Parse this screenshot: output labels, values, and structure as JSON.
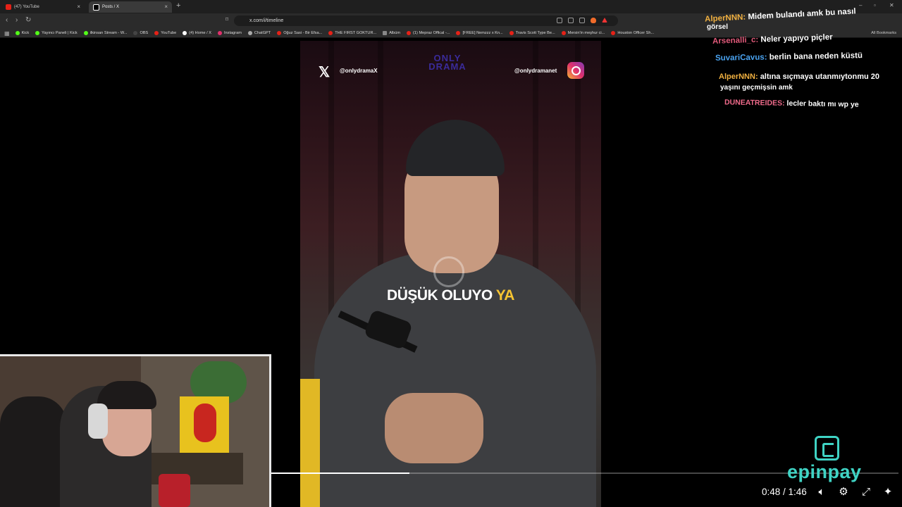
{
  "browser": {
    "tabs": [
      {
        "label": "(47) YouTube",
        "favicon_color": "#e62117"
      },
      {
        "label": "Posts / X",
        "favicon_color": "#ffffff"
      }
    ],
    "new_tab": "+",
    "address": "x.com/i/timeline",
    "bookmarks": [
      {
        "label": "Kick",
        "color": "#53fc18"
      },
      {
        "label": "Yayıncı Paneli | Kick",
        "color": "#53fc18"
      },
      {
        "label": "ilkinsan Stream - W...",
        "color": "#53fc18"
      },
      {
        "label": "OBS",
        "color": "#444444"
      },
      {
        "label": "YouTube",
        "color": "#e62117"
      },
      {
        "label": "(4) Home / X",
        "color": "#ffffff"
      },
      {
        "label": "Instagram",
        "color": "#e1306c"
      },
      {
        "label": "ChatGPT",
        "color": "#aaaaaa"
      },
      {
        "label": "Oğuz Sasi - Bir Efsa...",
        "color": "#e62117"
      },
      {
        "label": "THE FIRST GOKTUR...",
        "color": "#e62117"
      },
      {
        "label": "Albüm",
        "color": "#888888"
      },
      {
        "label": "(1) Mepraz Offical -...",
        "color": "#e62117"
      },
      {
        "label": "[FREE] Nemzzz x Kn...",
        "color": "#e62117"
      },
      {
        "label": "Travis Scott Type Be...",
        "color": "#e62117"
      },
      {
        "label": "Mersin'in meşhur ci...",
        "color": "#e62117"
      },
      {
        "label": "Houston Officer Sh...",
        "color": "#e62117"
      }
    ],
    "all_bookmarks": "All Bookmarks"
  },
  "video": {
    "handle_x": "@onlydramaX",
    "handle_ig": "@onlydramanet",
    "brand": "ONLY DRAMA",
    "subtitle_white": "DÜŞÜK OLUYO",
    "subtitle_yellow": "YA",
    "progress_fraction": 0.22,
    "time": "0:48 / 1:46"
  },
  "chat": [
    {
      "user": "AlperNNN:",
      "color": "#f0b040",
      "text": "Midem bulandı amk bu nasıl"
    },
    {
      "user": "",
      "color": "#ffffff",
      "text": "görsel"
    },
    {
      "user": "Arsenalli_c:",
      "color": "#e05a7a",
      "text": "Neler yapıyo piçler"
    },
    {
      "user": "SuvariCavus:",
      "color": "#4aa3f0",
      "text": "berlin bana neden küstü"
    },
    {
      "user": "AlperNNN:",
      "color": "#f0b040",
      "text": "altına sıçmaya utanmıytonmu 20"
    },
    {
      "user": "",
      "color": "#ffffff",
      "text": "yaşını geçmişsin amk"
    },
    {
      "user": "DUNEATREIDES:",
      "color": "#ee6a8a",
      "text": "lecler baktı mı wp ye"
    }
  ],
  "sponsor": "epinpay",
  "accent": "#3fd3c4"
}
